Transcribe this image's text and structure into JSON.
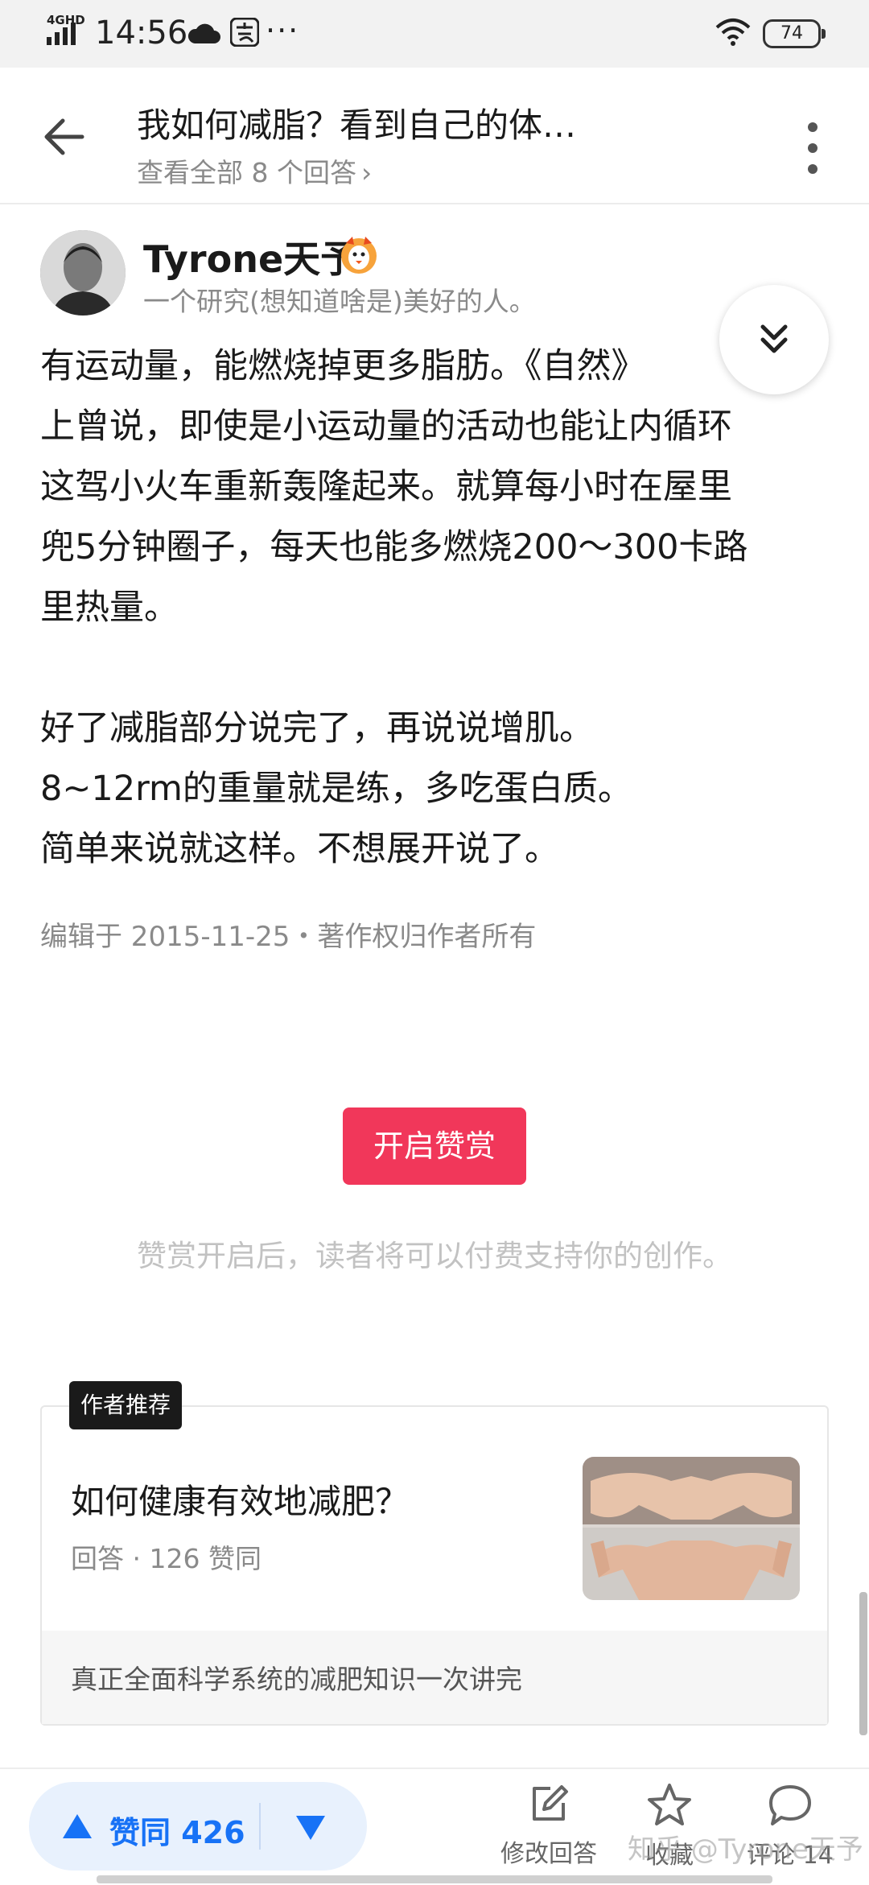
{
  "status_bar": {
    "network": "4GHD",
    "time": "14:56",
    "more": "···",
    "battery": "74"
  },
  "header": {
    "question_title": "我如何减脂？看到自己的体…",
    "view_all": "查看全部 8 个回答",
    "view_all_chevron": "›"
  },
  "author": {
    "name": "Tyrone天予",
    "bio": "一个研究(想知道啥是)美好的人。"
  },
  "answer": {
    "paragraphs_1": [
      "有运动量，能燃烧掉更多脂肪。《自然》",
      "上曾说，即使是小运动量的活动也能让内循环",
      "这驾小火车重新轰隆起来。就算每小时在屋里",
      "兜5分钟圈子，每天也能多燃烧200～300卡路",
      "里热量。"
    ],
    "paragraphs_2": [
      "好了减脂部分说完了，再说说增肌。",
      "8~12rm的重量就是练，多吃蛋白质。",
      "简单来说就这样。不想展开说了。"
    ],
    "edit_meta": "编辑于 2015-11-25・著作权归作者所有"
  },
  "reward": {
    "button_label": "开启赞赏",
    "hint": "赞赏开启后，读者将可以付费支持你的创作。"
  },
  "recommendation": {
    "tag": "作者推荐",
    "title": "如何健康有效地减肥？",
    "meta": "回答 · 126 赞同",
    "footer": "真正全面科学系统的减肥知识一次讲完"
  },
  "bottom_bar": {
    "upvote_label": "赞同 426",
    "edit_label": "修改回答",
    "favorite_label": "收藏",
    "comment_label": "评论 14",
    "watermark": "知乎 @Tyrone天予"
  },
  "colors": {
    "accent_blue": "#1772f6",
    "reward_pink": "#f1375a",
    "vote_bg": "#e8f1fd"
  }
}
